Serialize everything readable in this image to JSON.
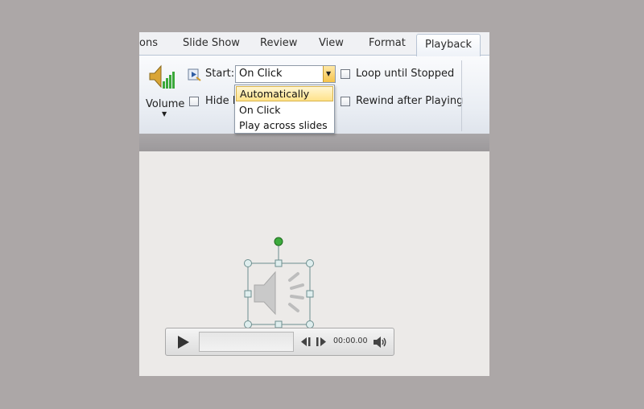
{
  "tabs": [
    {
      "label": "ons"
    },
    {
      "label": "Slide Show"
    },
    {
      "label": "Review"
    },
    {
      "label": "View"
    },
    {
      "label": "Format"
    },
    {
      "label": "Playback",
      "active": true
    }
  ],
  "ribbon": {
    "volume_label": "Volume",
    "start_label": "Start:",
    "start_value": "On Click",
    "hide_label": "Hide D",
    "loop_label": "Loop until Stopped",
    "rewind_label": "Rewind after Playing"
  },
  "dropdown": {
    "options": [
      "Automatically",
      "On Click",
      "Play across slides"
    ],
    "highlighted": "Automatically"
  },
  "player": {
    "time": "00:00.00"
  },
  "colors": {
    "accent_highlight": "#ffe28a",
    "selection_handle": "#8fbfbf",
    "rotate_handle": "#3daa3d"
  }
}
